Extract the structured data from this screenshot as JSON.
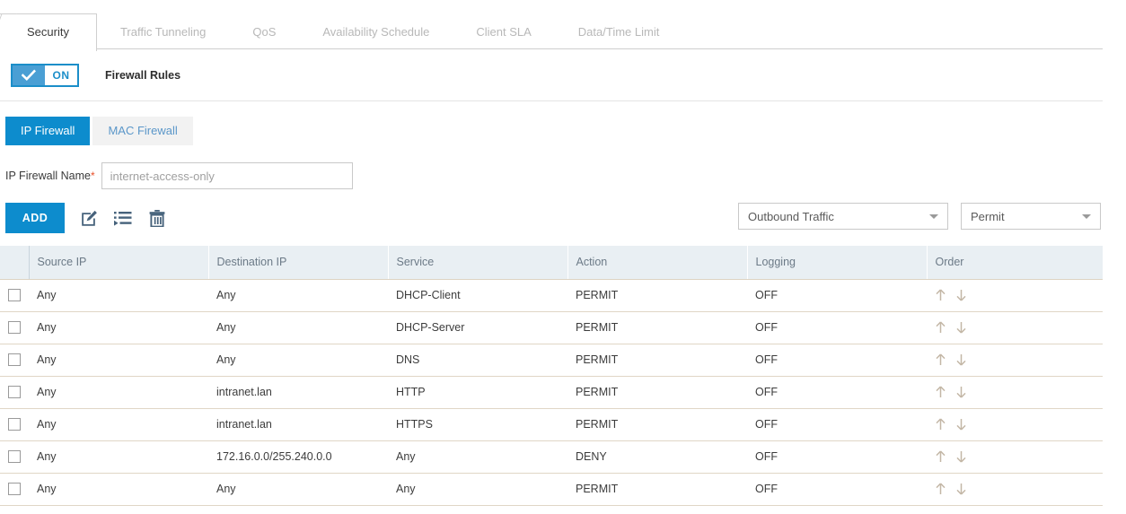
{
  "tabs": [
    {
      "label": "Security",
      "active": true
    },
    {
      "label": "Traffic Tunneling",
      "active": false
    },
    {
      "label": "QoS",
      "active": false
    },
    {
      "label": "Availability Schedule",
      "active": false
    },
    {
      "label": "Client SLA",
      "active": false
    },
    {
      "label": "Data/Time Limit",
      "active": false
    }
  ],
  "toggle": {
    "state_label": "ON",
    "enabled": true,
    "accent": "#1b8ec9"
  },
  "section": {
    "title": "Firewall Rules"
  },
  "segments": [
    {
      "label": "IP Firewall",
      "selected": true
    },
    {
      "label": "MAC Firewall",
      "selected": false
    }
  ],
  "form": {
    "name_label": "IP Firewall Name",
    "required_marker": "*",
    "name_value": "internet-access-only",
    "name_placeholder": "internet-access-only"
  },
  "toolbar": {
    "add_label": "ADD",
    "icons": [
      {
        "name": "edit-icon",
        "title": "Edit"
      },
      {
        "name": "insert-icon",
        "title": "Insert"
      },
      {
        "name": "delete-icon",
        "title": "Delete"
      }
    ]
  },
  "filters": {
    "direction": {
      "value": "Outbound Traffic"
    },
    "action": {
      "value": "Permit"
    }
  },
  "table": {
    "columns": [
      "Source IP",
      "Destination IP",
      "Service",
      "Action",
      "Logging",
      "Order"
    ],
    "rows": [
      {
        "source": "Any",
        "destination": "Any",
        "service": "DHCP-Client",
        "action": "PERMIT",
        "logging": "OFF"
      },
      {
        "source": "Any",
        "destination": "Any",
        "service": "DHCP-Server",
        "action": "PERMIT",
        "logging": "OFF"
      },
      {
        "source": "Any",
        "destination": "Any",
        "service": "DNS",
        "action": "PERMIT",
        "logging": "OFF"
      },
      {
        "source": "Any",
        "destination": "intranet.lan",
        "service": "HTTP",
        "action": "PERMIT",
        "logging": "OFF"
      },
      {
        "source": "Any",
        "destination": "intranet.lan",
        "service": "HTTPS",
        "action": "PERMIT",
        "logging": "OFF"
      },
      {
        "source": "Any",
        "destination": "172.16.0.0/255.240.0.0",
        "service": "Any",
        "action": "DENY",
        "logging": "OFF"
      },
      {
        "source": "Any",
        "destination": "Any",
        "service": "Any",
        "action": "PERMIT",
        "logging": "OFF"
      }
    ]
  },
  "colors": {
    "accent_blue": "#0d8ccd",
    "toggle_blue": "#1b8ec9",
    "header_bg": "#e9eff3",
    "row_border": "#e0d6c6",
    "required_red": "#e8502a"
  }
}
